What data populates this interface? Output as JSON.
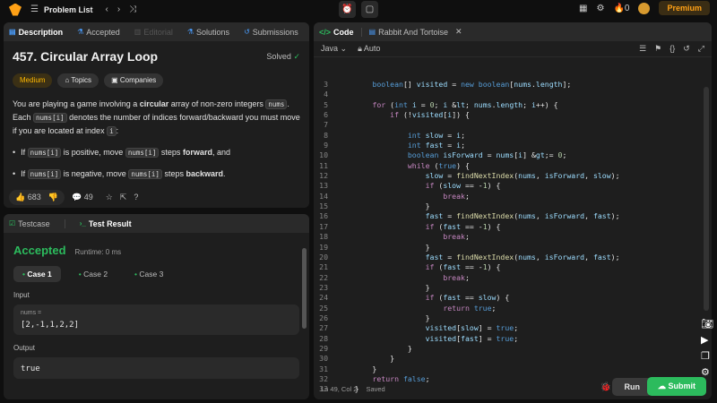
{
  "topbar": {
    "problem_list": "Problem List",
    "streak": "0",
    "premium": "Premium"
  },
  "desc_tabs": [
    {
      "label": "Description"
    },
    {
      "label": "Accepted"
    },
    {
      "label": "Editorial"
    },
    {
      "label": "Solutions"
    },
    {
      "label": "Submissions"
    }
  ],
  "problem": {
    "title": "457. Circular Array Loop",
    "solved": "Solved",
    "difficulty": "Medium",
    "topics": "Topics",
    "companies": "Companies",
    "p1_a": "You are playing a game involving a ",
    "p1_b": "circular",
    "p1_c": " array of non-zero integers ",
    "nums": "nums",
    "p1_d": ". Each ",
    "nums_i": "nums[i]",
    "p1_e": " denotes the number of indices forward/backward you must move if you are located at index ",
    "i": "i",
    "p1_f": ":",
    "b1_a": "If ",
    "b1_b": " is positive, move ",
    "b1_c": " steps ",
    "b1_d": "forward",
    "b1_e": ", and",
    "b2_a": "If ",
    "b2_b": " is negative, move ",
    "b2_c": " steps ",
    "b2_d": "backward",
    "b2_e": "."
  },
  "stats": {
    "likes": "683",
    "comments": "49"
  },
  "result_tabs": {
    "testcase": "Testcase",
    "test_result": "Test Result"
  },
  "result": {
    "status": "Accepted",
    "runtime": "Runtime: 0 ms",
    "cases": [
      "Case 1",
      "Case 2",
      "Case 3"
    ],
    "input_label": "Input",
    "var_name": "nums =",
    "var_value": "[2,-1,1,2,2]",
    "output_label": "Output",
    "output_value": "true"
  },
  "code_tabs": {
    "code": "Code",
    "file": "Rabbit And Tortoise"
  },
  "editor": {
    "language": "Java",
    "mode": "Auto",
    "status_pos": "Ln 49, Col 2",
    "status_saved": "Saved",
    "run": "Run",
    "submit": "Submit"
  },
  "code_lines": [
    {
      "n": "3",
      "t": "        boolean[] visited = new boolean[nums.length];"
    },
    {
      "n": "4",
      "t": ""
    },
    {
      "n": "5",
      "t": "        for (int i = 0; i < nums.length; i++) {"
    },
    {
      "n": "6",
      "t": "            if (!visited[i]) {"
    },
    {
      "n": "7",
      "t": ""
    },
    {
      "n": "8",
      "t": "                int slow = i;"
    },
    {
      "n": "9",
      "t": "                int fast = i;"
    },
    {
      "n": "10",
      "t": "                boolean isForward = nums[i] >= 0;"
    },
    {
      "n": "11",
      "t": "                while (true) {"
    },
    {
      "n": "12",
      "t": "                    slow = findNextIndex(nums, isForward, slow);"
    },
    {
      "n": "13",
      "t": "                    if (slow == -1) {"
    },
    {
      "n": "14",
      "t": "                        break;"
    },
    {
      "n": "15",
      "t": "                    }"
    },
    {
      "n": "16",
      "t": "                    fast = findNextIndex(nums, isForward, fast);"
    },
    {
      "n": "17",
      "t": "                    if (fast == -1) {"
    },
    {
      "n": "18",
      "t": "                        break;"
    },
    {
      "n": "19",
      "t": "                    }"
    },
    {
      "n": "20",
      "t": "                    fast = findNextIndex(nums, isForward, fast);"
    },
    {
      "n": "21",
      "t": "                    if (fast == -1) {"
    },
    {
      "n": "22",
      "t": "                        break;"
    },
    {
      "n": "23",
      "t": "                    }"
    },
    {
      "n": "24",
      "t": "                    if (fast == slow) {"
    },
    {
      "n": "25",
      "t": "                        return true;"
    },
    {
      "n": "26",
      "t": "                    }"
    },
    {
      "n": "27",
      "t": "                    visited[slow] = true;"
    },
    {
      "n": "28",
      "t": "                    visited[fast] = true;"
    },
    {
      "n": "29",
      "t": "                }"
    },
    {
      "n": "30",
      "t": "            }"
    },
    {
      "n": "31",
      "t": "        }"
    },
    {
      "n": "32",
      "t": "        return false;"
    },
    {
      "n": "33",
      "t": "    }"
    }
  ],
  "colors": {
    "accent": "#ffa116",
    "green": "#2cbb5d",
    "blue": "#4a9eff"
  }
}
